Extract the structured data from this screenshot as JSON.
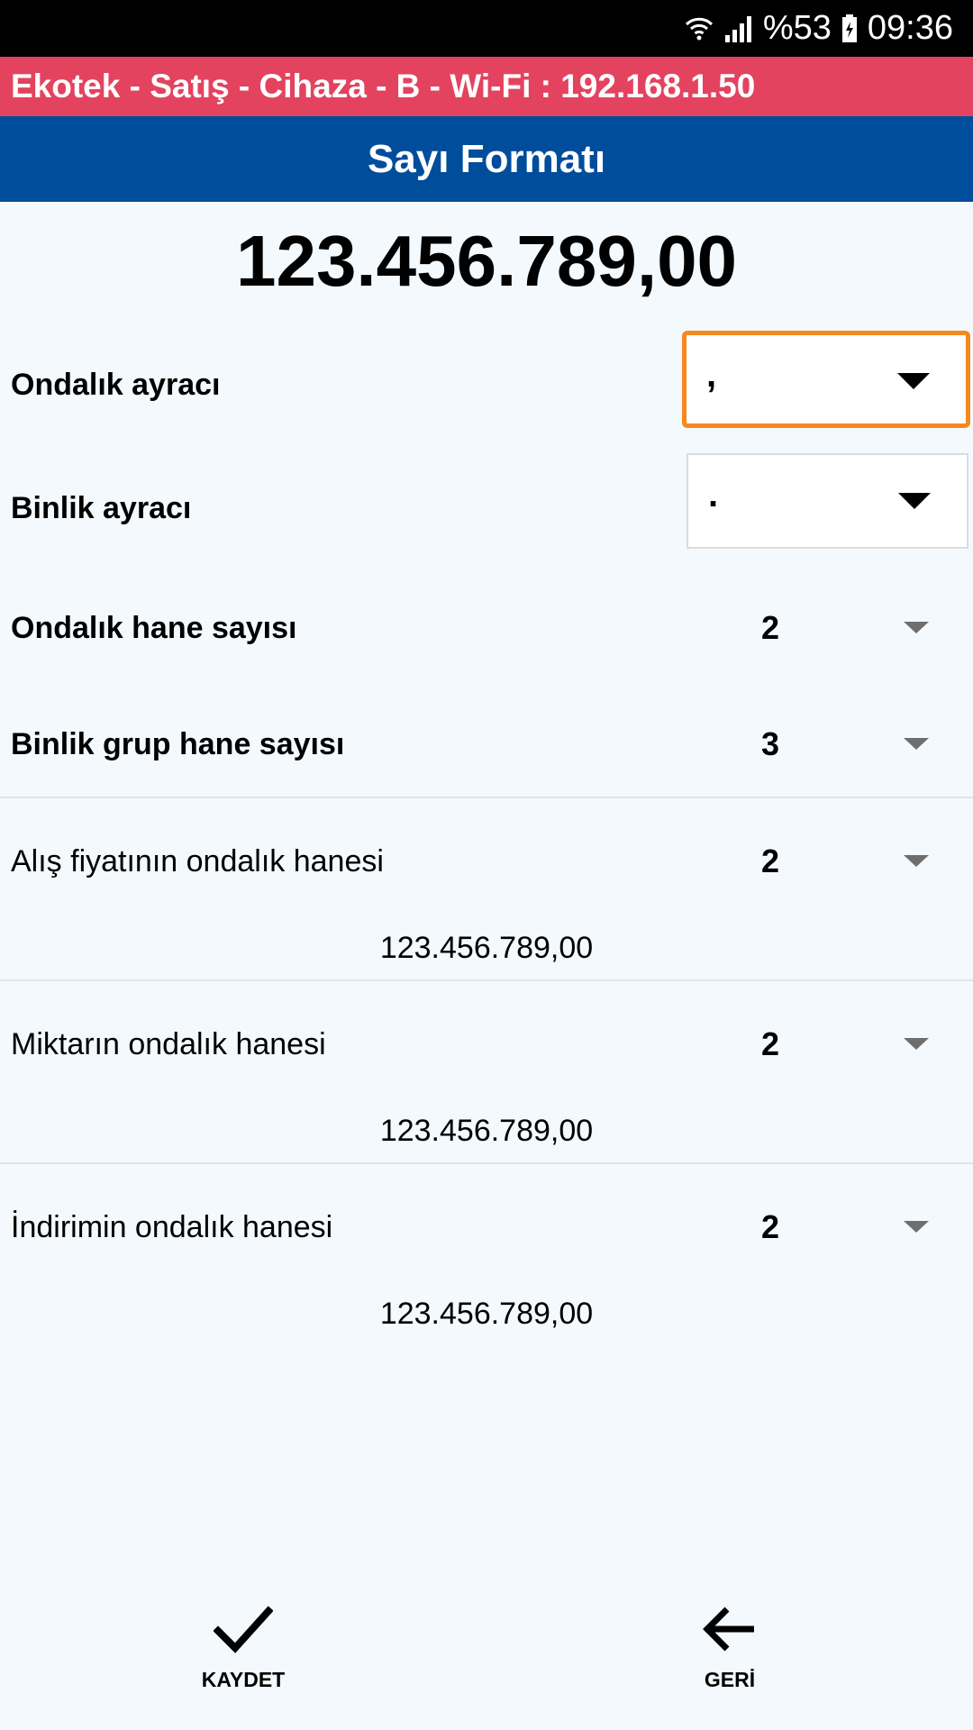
{
  "status_bar": {
    "battery_percent": "%53",
    "time": "09:36",
    "icons": [
      "wifi-icon",
      "signal-icon",
      "battery-icon"
    ]
  },
  "app_bar": {
    "title": "Ekotek - Satış - Cihaza - B - Wi-Fi : 192.168.1.50",
    "color": "#e3435f"
  },
  "title_bar": {
    "title": "Sayı Formatı",
    "color": "#004d9c"
  },
  "preview": {
    "value": "123.456.789,00"
  },
  "settings": {
    "decimal_separator": {
      "label": "Ondalık ayracı",
      "value": ","
    },
    "thousands_separator": {
      "label": "Binlik ayracı",
      "value": "."
    },
    "decimal_places": {
      "label": "Ondalık hane sayısı",
      "value": "2"
    },
    "group_size": {
      "label": "Binlik grup hane sayısı",
      "value": "3"
    }
  },
  "decimal_fields": [
    {
      "label": "Alış fiyatının ondalık hanesi",
      "value": "2",
      "sample": "123.456.789,00"
    },
    {
      "label": "Miktarın ondalık hanesi",
      "value": "2",
      "sample": "123.456.789,00"
    },
    {
      "label": "İndirimin ondalık hanesi",
      "value": "2",
      "sample": "123.456.789,00"
    }
  ],
  "bottom_bar": {
    "save_label": "KAYDET",
    "back_label": "GERİ",
    "save_icon": "check-icon",
    "back_icon": "arrow-left-icon"
  },
  "colors": {
    "focus": "#f5891f",
    "background": "#f4f9fd"
  }
}
